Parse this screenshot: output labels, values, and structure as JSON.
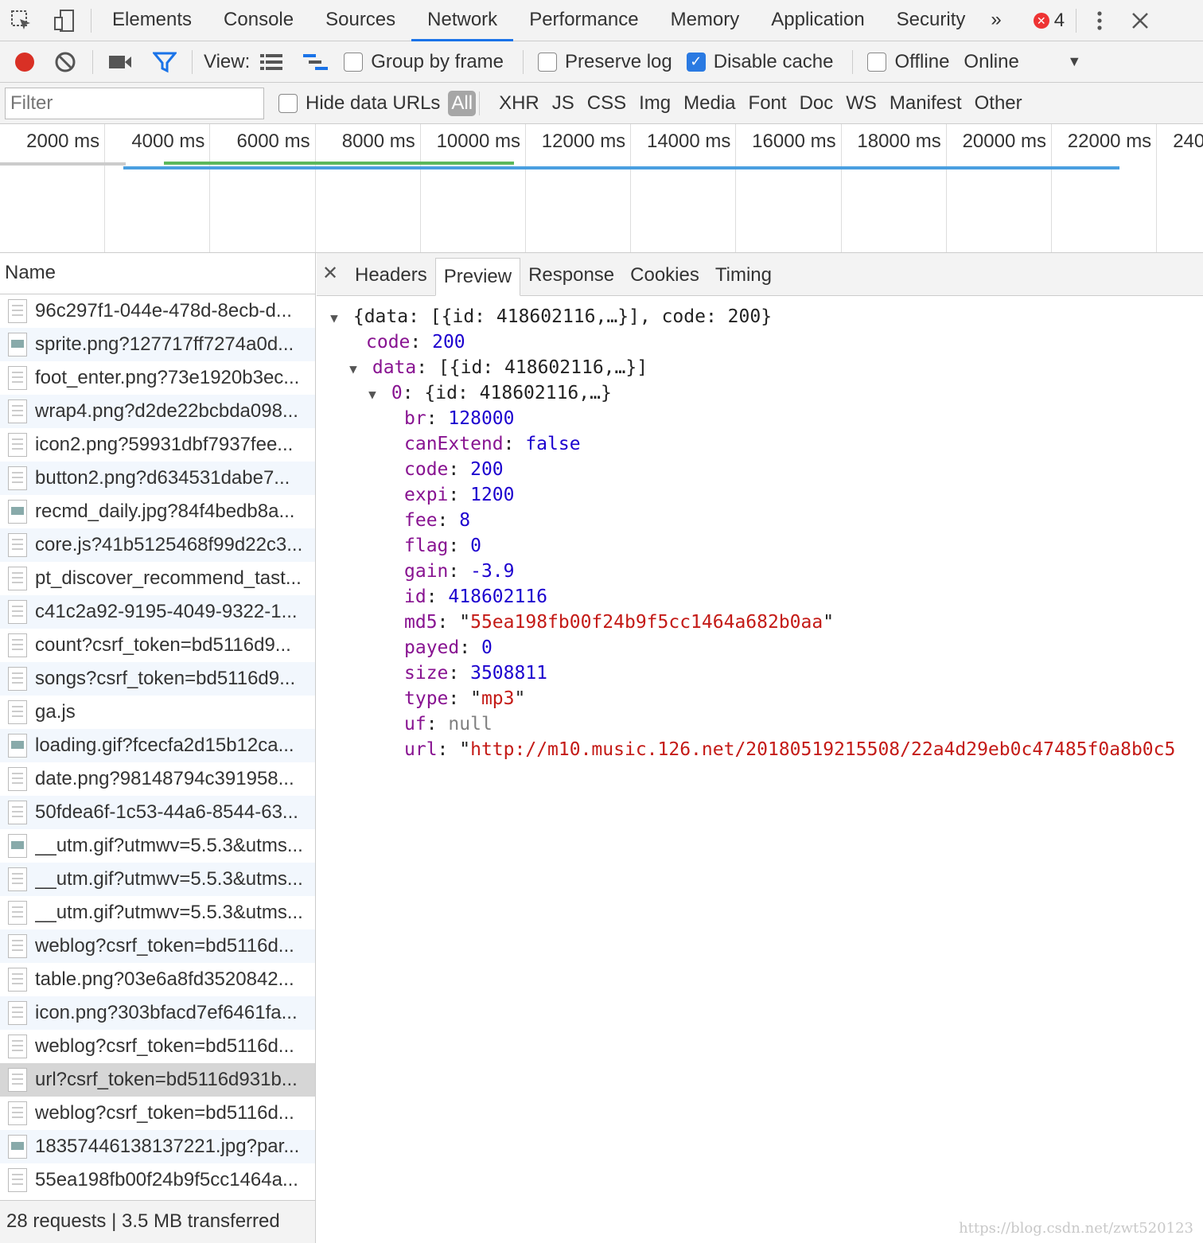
{
  "tabs": [
    "Elements",
    "Console",
    "Sources",
    "Network",
    "Performance",
    "Memory",
    "Application",
    "Security"
  ],
  "active_tab": "Network",
  "more_tabs_label": "»",
  "error_count": "4",
  "toolbar": {
    "view_label": "View:",
    "group_by_frame": "Group by frame",
    "preserve_log": "Preserve log",
    "disable_cache": "Disable cache",
    "offline": "Offline",
    "throttle": "Online"
  },
  "filter": {
    "placeholder": "Filter",
    "hide_data_urls": "Hide data URLs",
    "types": [
      "All",
      "XHR",
      "JS",
      "CSS",
      "Img",
      "Media",
      "Font",
      "Doc",
      "WS",
      "Manifest",
      "Other"
    ]
  },
  "timeline_ticks": [
    "2000 ms",
    "4000 ms",
    "6000 ms",
    "8000 ms",
    "10000 ms",
    "12000 ms",
    "14000 ms",
    "16000 ms",
    "18000 ms",
    "20000 ms",
    "22000 ms",
    "240"
  ],
  "colors": {
    "accent": "#1a73e8",
    "record": "#d93025",
    "dom_content_loaded": "#5cb85c",
    "load": "#4a9fe0"
  },
  "request_list": {
    "header": "Name",
    "items": [
      "96c297f1-044e-478d-8ecb-d...",
      "sprite.png?127717ff7274a0d...",
      "foot_enter.png?73e1920b3ec...",
      "wrap4.png?d2de22bcbda098...",
      "icon2.png?59931dbf7937fee...",
      "button2.png?d634531dabe7...",
      "recmd_daily.jpg?84f4bedb8a...",
      "core.js?41b5125468f99d22c3...",
      "pt_discover_recommend_tast...",
      "c41c2a92-9195-4049-9322-1...",
      "count?csrf_token=bd5116d9...",
      "songs?csrf_token=bd5116d9...",
      "ga.js",
      "loading.gif?fcecfa2d15b12ca...",
      "date.png?98148794c391958...",
      "50fdea6f-1c53-44a6-8544-63...",
      "__utm.gif?utmwv=5.5.3&utms...",
      "__utm.gif?utmwv=5.5.3&utms...",
      "__utm.gif?utmwv=5.5.3&utms...",
      "weblog?csrf_token=bd5116d...",
      "table.png?03e6a8fd3520842...",
      "icon.png?303bfacd7ef6461fa...",
      "weblog?csrf_token=bd5116d...",
      "url?csrf_token=bd5116d931b...",
      "weblog?csrf_token=bd5116d...",
      "18357446138137221.jpg?par...",
      "55ea198fb00f24b9f5cc1464a..."
    ],
    "selected_index": 23,
    "footer": "28 requests | 3.5 MB transferred"
  },
  "detail_tabs": [
    "Headers",
    "Preview",
    "Response",
    "Cookies",
    "Timing"
  ],
  "active_detail_tab": "Preview",
  "preview": {
    "root_summary": "{data: [{id: 418602116,…}], code: 200}",
    "code_key": "code",
    "code_val": "200",
    "data_key": "data",
    "data_summary": "[{id: 418602116,…}]",
    "item_key": "0",
    "item_summary": "{id: 418602116,…}",
    "fields": [
      {
        "key": "br",
        "val": "128000",
        "kind": "n"
      },
      {
        "key": "canExtend",
        "val": "false",
        "kind": "n"
      },
      {
        "key": "code",
        "val": "200",
        "kind": "n"
      },
      {
        "key": "expi",
        "val": "1200",
        "kind": "n"
      },
      {
        "key": "fee",
        "val": "8",
        "kind": "n"
      },
      {
        "key": "flag",
        "val": "0",
        "kind": "n"
      },
      {
        "key": "gain",
        "val": "-3.9",
        "kind": "n"
      },
      {
        "key": "id",
        "val": "418602116",
        "kind": "n"
      },
      {
        "key": "md5",
        "val": "55ea198fb00f24b9f5cc1464a682b0aa",
        "kind": "s"
      },
      {
        "key": "payed",
        "val": "0",
        "kind": "n"
      },
      {
        "key": "size",
        "val": "3508811",
        "kind": "n"
      },
      {
        "key": "type",
        "val": "mp3",
        "kind": "s"
      },
      {
        "key": "uf",
        "val": "null",
        "kind": "nul"
      },
      {
        "key": "url",
        "val": "http://m10.music.126.net/20180519215508/22a4d29eb0c47485f0a8b0c5",
        "kind": "s",
        "open": true
      }
    ]
  },
  "watermark": "https://blog.csdn.net/zwt520123"
}
